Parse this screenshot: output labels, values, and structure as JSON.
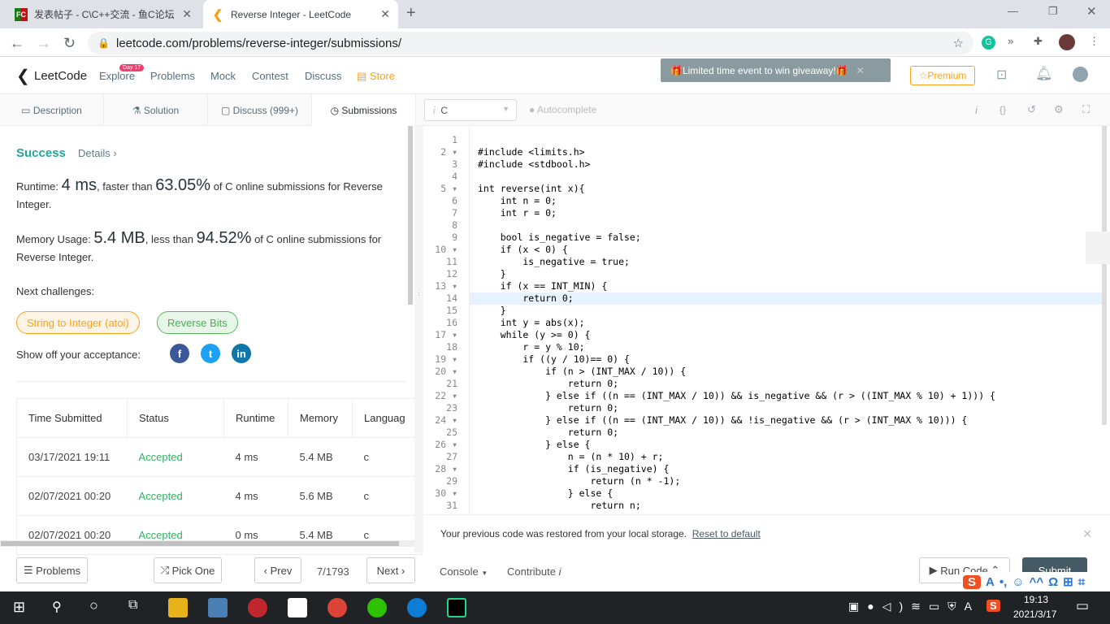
{
  "browser": {
    "tabs": [
      {
        "title": "发表帖子 - C\\C++交流 - 鱼C论坛",
        "favicon": "FC"
      },
      {
        "title": "Reverse Integer - LeetCode",
        "active": true
      }
    ],
    "url": "leetcode.com/problems/reverse-integer/submissions/"
  },
  "nav": {
    "logo": "LeetCode",
    "badge": "Day 17",
    "items": [
      "Explore",
      "Problems",
      "Mock",
      "Contest",
      "Discuss"
    ],
    "store": "Store",
    "promo": "Limited time event to win giveaway!",
    "premium": "Premium"
  },
  "subtabs": [
    "Description",
    "Solution",
    "Discuss (999+)",
    "Submissions"
  ],
  "editor_toolbar": {
    "language": "C",
    "autocomplete": "Autocomplete"
  },
  "result": {
    "status": "Success",
    "details": "Details",
    "runtime_label": "Runtime: ",
    "runtime": "4 ms",
    "runtime_mid": ", faster than ",
    "runtime_pct": "63.05%",
    "runtime_tail": " of C online submissions for Reverse Integer.",
    "memory_label": "Memory Usage: ",
    "memory": "5.4 MB",
    "memory_mid": ", less than ",
    "memory_pct": "94.52%",
    "memory_tail": " of C online submissions for Reverse Integer.",
    "next_label": "Next challenges:",
    "challenges": [
      "String to Integer (atoi)",
      "Reverse Bits"
    ],
    "share_label": "Show off your acceptance:"
  },
  "table": {
    "headers": [
      "Time Submitted",
      "Status",
      "Runtime",
      "Memory",
      "Languag"
    ],
    "rows": [
      [
        "03/17/2021 19:11",
        "Accepted",
        "4 ms",
        "5.4 MB",
        "c"
      ],
      [
        "02/07/2021 00:20",
        "Accepted",
        "4 ms",
        "5.6 MB",
        "c"
      ],
      [
        "02/07/2021 00:20",
        "Accepted",
        "0 ms",
        "5.4 MB",
        "c"
      ]
    ]
  },
  "code": [
    "",
    "#include <limits.h>",
    "#include <stdbool.h>",
    "",
    "int reverse(int x){",
    "    int n = 0;",
    "    int r = 0;",
    "",
    "    bool is_negative = false;",
    "    if (x < 0) {",
    "        is_negative = true;",
    "    }",
    "    if (x == INT_MIN) {",
    "        return 0;",
    "    }",
    "    int y = abs(x);",
    "    while (y >= 0) {",
    "        r = y % 10;",
    "        if ((y / 10)== 0) {",
    "            if (n > (INT_MAX / 10)) {",
    "                return 0;",
    "            } else if ((n == (INT_MAX / 10)) && is_negative && (r > ((INT_MAX % 10) + 1))) {",
    "                return 0;",
    "            } else if ((n == (INT_MAX / 10)) && !is_negative && (r > (INT_MAX % 10))) {",
    "                return 0;",
    "            } else {",
    "                n = (n * 10) + r;",
    "                if (is_negative) {",
    "                    return (n * -1);",
    "                } else {",
    "                    return n;"
  ],
  "fold_lines": [
    2,
    5,
    10,
    13,
    17,
    19,
    20,
    22,
    24,
    26,
    28,
    30
  ],
  "highlight_line": 14,
  "notice": {
    "text": "Your previous code was restored from your local storage.",
    "link": "Reset to default"
  },
  "footer": {
    "problems": "Problems",
    "pick": "Pick One",
    "prev": "Prev",
    "page": "7/1793",
    "next": "Next",
    "console": "Console",
    "contribute": "Contribute",
    "run": "Run Code",
    "submit": "Submit"
  },
  "taskbar": {
    "time": "19:13",
    "date": "2021/3/17"
  },
  "colors": {
    "success": "#2db55d",
    "accent": "#ffa116",
    "teal": "#26a69a"
  }
}
